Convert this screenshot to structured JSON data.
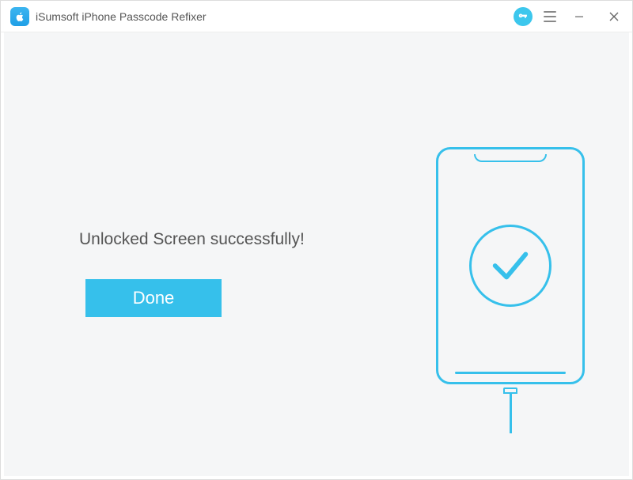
{
  "app": {
    "title": "iSumsoft iPhone Passcode Refixer"
  },
  "result": {
    "message": "Unlocked Screen successfully!",
    "done_label": "Done"
  },
  "icons": {
    "logo": "apple-logo-icon",
    "key": "key-icon",
    "menu": "hamburger-icon",
    "minimize": "minimize-icon",
    "close": "close-icon",
    "checkmark": "check-icon",
    "phone": "phone-outline-icon"
  },
  "colors": {
    "accent": "#36c0eb",
    "text": "#555555",
    "bg": "#f5f6f7"
  }
}
